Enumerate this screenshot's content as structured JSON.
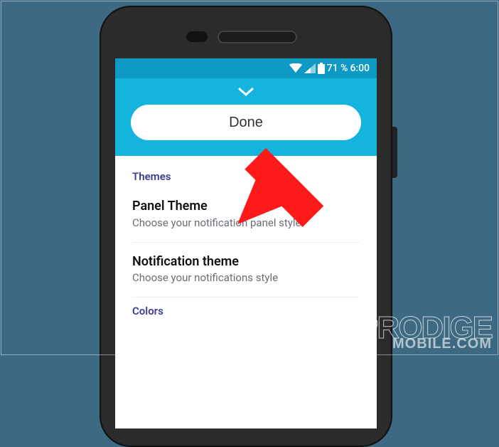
{
  "statusbar": {
    "battery_pct": "71 %",
    "time": "6:00"
  },
  "header": {
    "done_label": "Done"
  },
  "sections": {
    "themes_label": "Themes",
    "colors_label": "Colors"
  },
  "items": {
    "panel_theme": {
      "title": "Panel Theme",
      "sub": "Choose your notification panel style"
    },
    "notification_theme": {
      "title": "Notification theme",
      "sub": "Choose your notifications style"
    }
  },
  "watermark": {
    "line1": "PRODIGE",
    "line2": "MOBILE.COM"
  }
}
